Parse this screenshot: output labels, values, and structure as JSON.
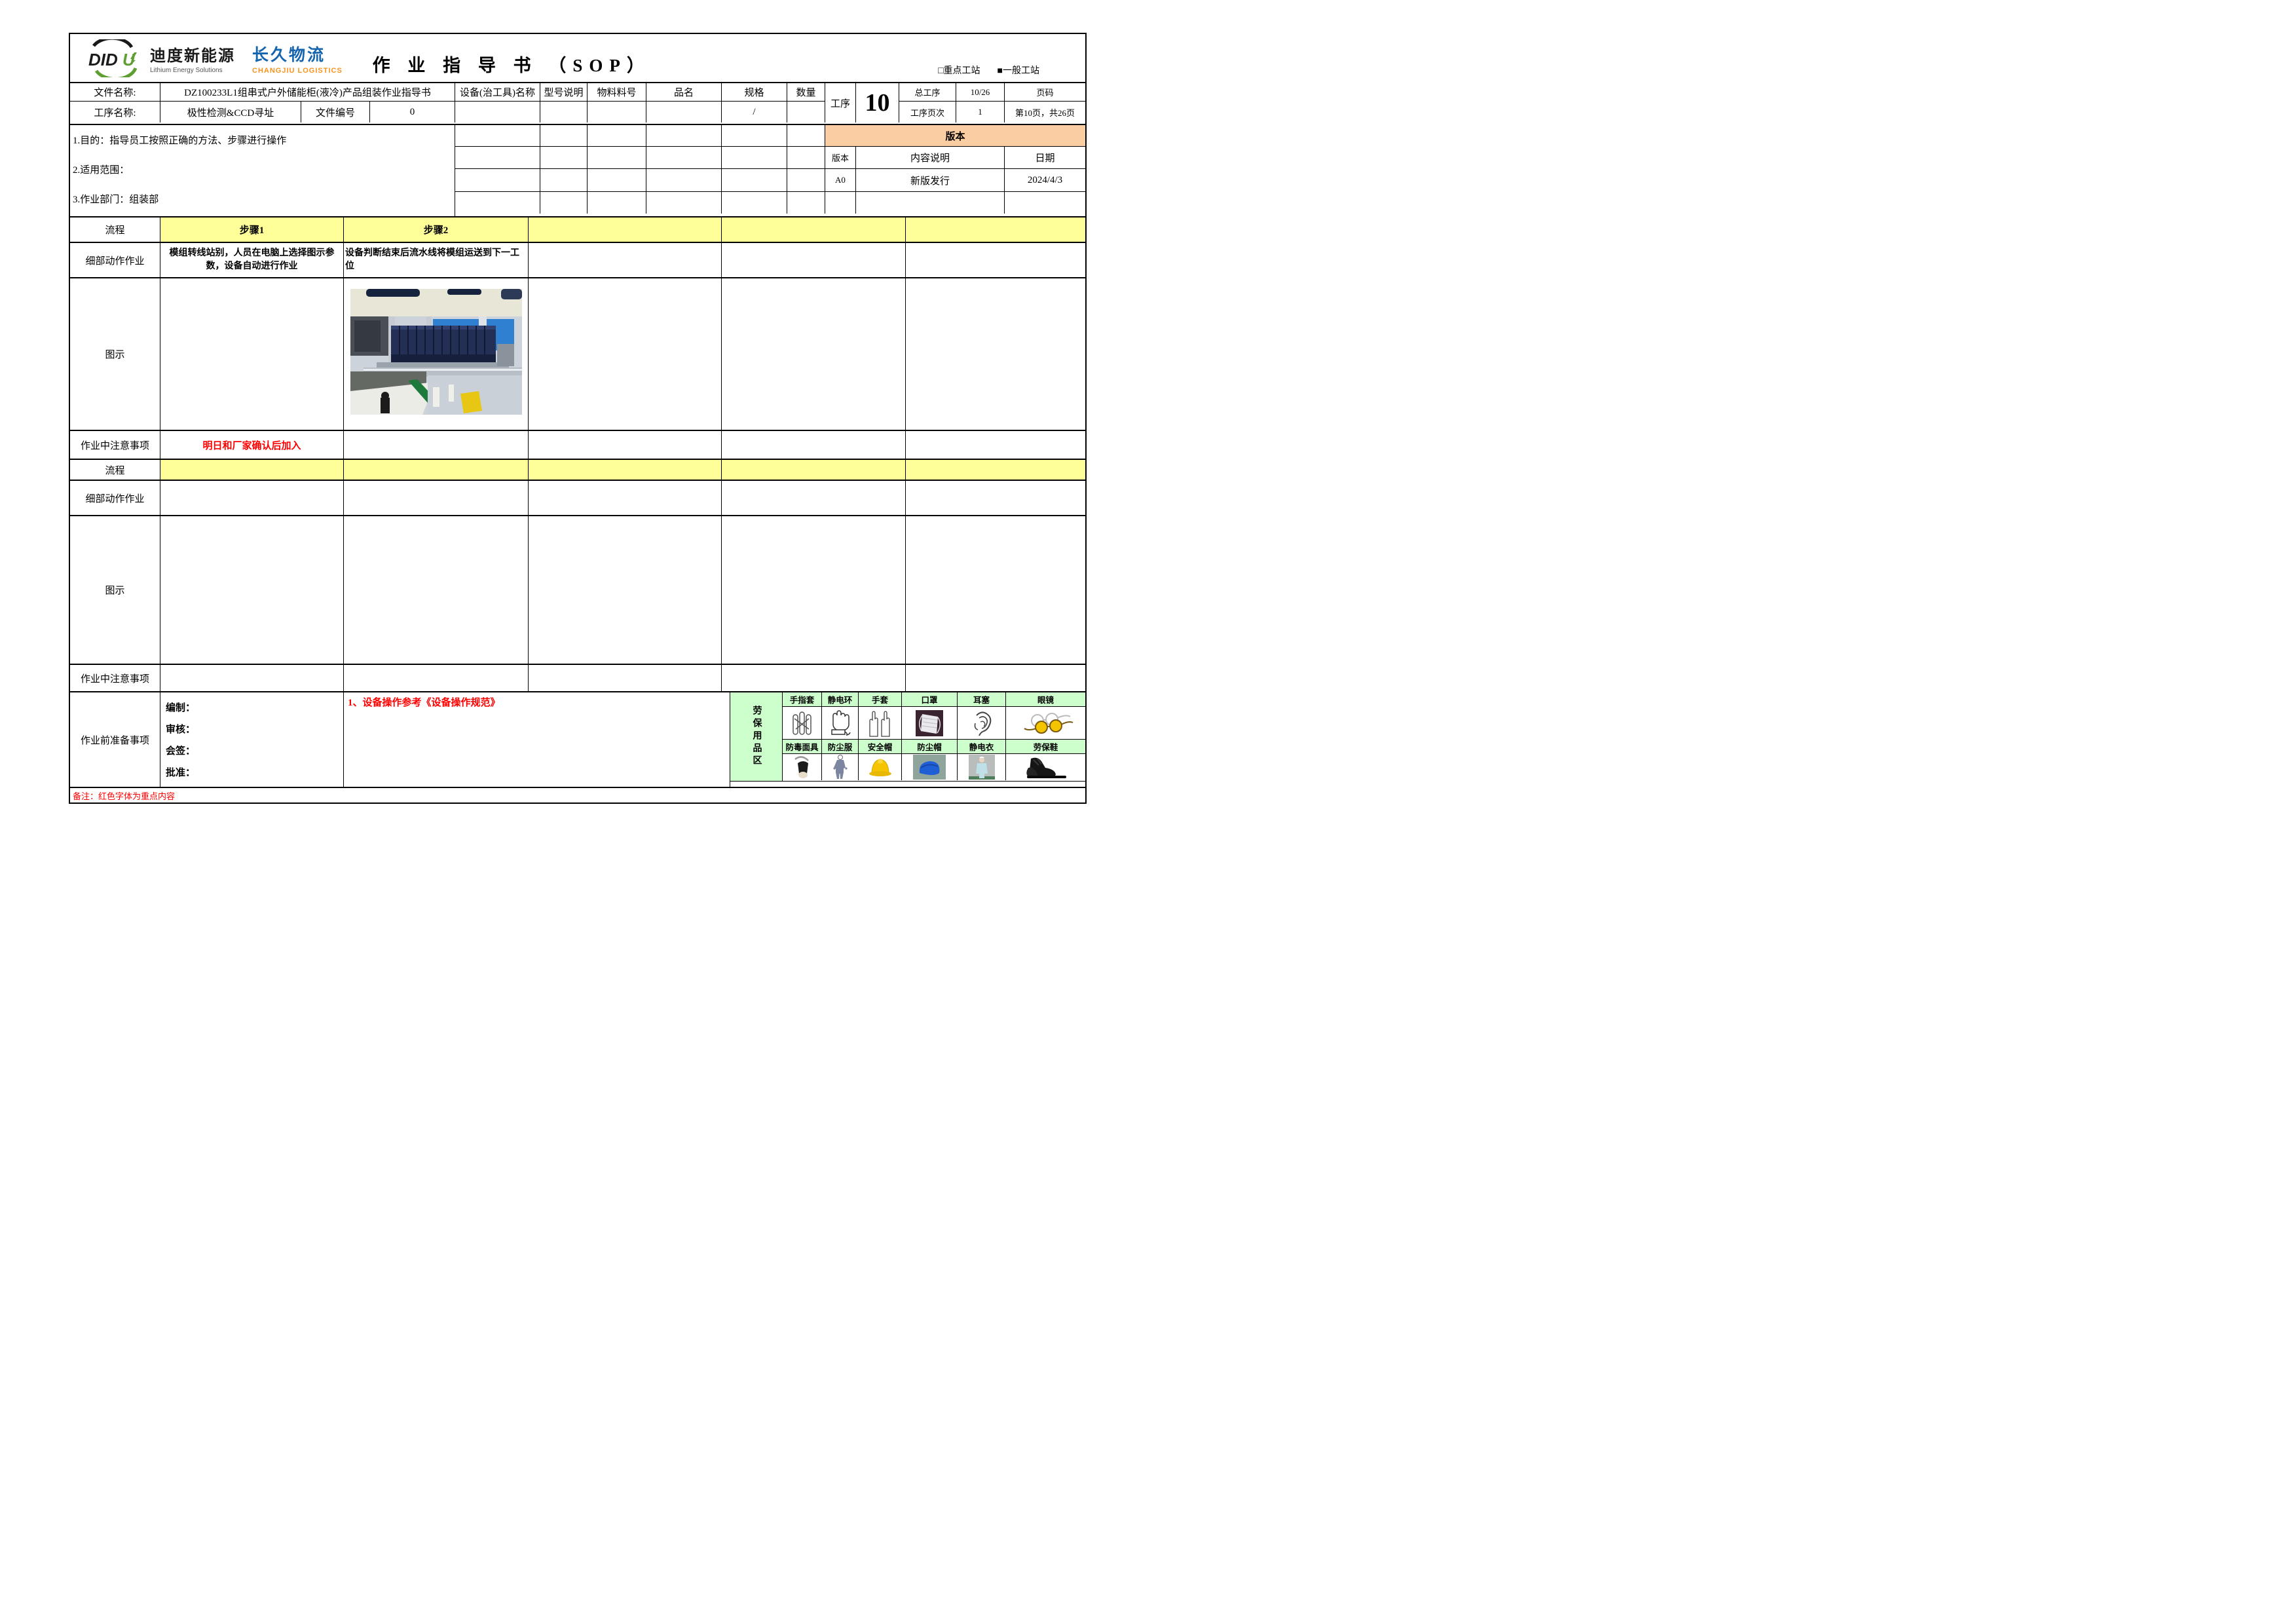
{
  "header": {
    "logo_didu": {
      "brand": "DIDU",
      "name": "迪度新能源",
      "tagline": "Lithium Energy Solutions"
    },
    "logo_changjiu": {
      "name": "长久物流",
      "sub": "CHANGJIU LOGISTICS"
    },
    "title": "作 业 指 导 书 （SOP）",
    "station_key": "□重点工站",
    "station_general": "■一般工站"
  },
  "info": {
    "doc_name_label": "文件名称:",
    "doc_name": "DZ100233L1组串式户外储能柜(液冷)产品组装作业指导书",
    "equipment_label": "设备(治工具)名称",
    "model_label": "型号说明",
    "material_label": "物料料号",
    "part_label": "品名",
    "spec_label": "规格",
    "qty_label": "数量",
    "spec_value": "/",
    "step_name_label": "工序名称:",
    "step_name": "极性检测&CCD寻址",
    "doc_no_label": "文件编号",
    "doc_no": "0",
    "process_label": "工序",
    "process_no": "10",
    "total_process_label": "总工序",
    "total_process": "10/26",
    "page_label": "页码",
    "process_page_label": "工序页次",
    "process_page": "1",
    "page_info": "第10页，共26页"
  },
  "purpose": {
    "line1": "1.目的：指导员工按照正确的方法、步骤进行操作",
    "line2": "2.适用范围：",
    "line3": "3.作业部门：组装部"
  },
  "version": {
    "banner": "版本",
    "col_version": "版本",
    "col_desc": "内容说明",
    "col_date": "日期",
    "rows": [
      {
        "version": "A0",
        "desc": "新版发行",
        "date": "2024/4/3"
      }
    ]
  },
  "section1": {
    "flow_label": "流程",
    "step1": "步骤1",
    "step2": "步骤2",
    "detail_label": "细部动作作业",
    "detail_step1": "模组转线站别，人员在电脑上选择图示参数，设备自动进行作业",
    "detail_step2": "设备判断结束后流水线将模组运送到下一工位",
    "diagram_label": "图示",
    "caution_label": "作业中注意事项",
    "caution_step1": "明日和厂家确认后加入"
  },
  "section2": {
    "flow_label": "流程",
    "detail_label": "细部动作作业",
    "diagram_label": "图示",
    "caution_label": "作业中注意事项"
  },
  "prep": {
    "label": "作业前准备事项",
    "sign_labels": [
      "编制：",
      "审核：",
      "会签：",
      "批准："
    ],
    "red_note": "1、设备操作参考《设备操作规范》"
  },
  "ppe": {
    "area_label": "劳保用品区",
    "row1": [
      {
        "label": "手指套",
        "icon": "finger-cots-icon"
      },
      {
        "label": "静电环",
        "icon": "esd-wrist-strap-icon"
      },
      {
        "label": "手套",
        "icon": "gloves-icon"
      },
      {
        "label": "口罩",
        "icon": "face-mask-icon"
      },
      {
        "label": "耳塞",
        "icon": "ear-plugs-icon"
      },
      {
        "label": "眼镜",
        "icon": "safety-glasses-icon"
      }
    ],
    "row2": [
      {
        "label": "防毒面具",
        "icon": "respirator-icon"
      },
      {
        "label": "防尘服",
        "icon": "dust-suit-icon"
      },
      {
        "label": "安全帽",
        "icon": "hard-hat-icon"
      },
      {
        "label": "防尘帽",
        "icon": "dust-cap-icon"
      },
      {
        "label": "静电衣",
        "icon": "esd-garment-icon"
      },
      {
        "label": "劳保鞋",
        "icon": "safety-shoes-icon"
      }
    ]
  },
  "footer": {
    "note": "备注：红色字体为重点内容"
  },
  "colors": {
    "highlight_yellow": "#FFFF99",
    "version_peach": "#FACDA2",
    "ppe_green": "#CCFFCC",
    "emphasis_red": "#FF0000",
    "logo_blue": "#1565AE",
    "logo_orange": "#F7941D",
    "logo_green": "#5F9E32"
  }
}
